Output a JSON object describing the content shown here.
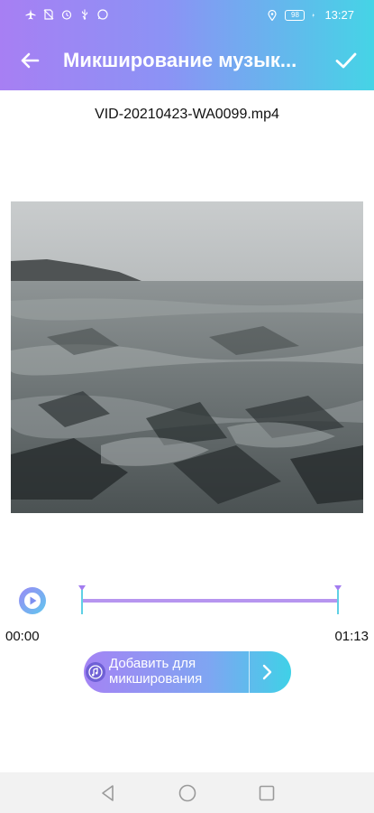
{
  "statusbar": {
    "icons_left": [
      "airplane-icon",
      "no-sim-icon",
      "alarm-icon",
      "usb-icon",
      "whatsapp-icon"
    ],
    "icons_right": [
      "location-icon",
      "battery-icon",
      "charging-icon"
    ],
    "battery": "98",
    "time": "13:27"
  },
  "header": {
    "title": "Микширование музык...",
    "back_icon": "arrow-left-icon",
    "done_icon": "checkmark-icon",
    "gradient": [
      "#a77ff3",
      "#45d4e6"
    ]
  },
  "video": {
    "filename": "VID-20210423-WA0099.mp4"
  },
  "player": {
    "play_icon": "play-icon",
    "start_time": "00:00",
    "end_time": "01:13",
    "track_color": "#b695ef"
  },
  "add_music": {
    "label": "Добавить для микширования",
    "icon": "music-add-icon",
    "arrow_icon": "chevron-right-icon"
  },
  "navbar": {
    "icons": [
      "nav-back-icon",
      "nav-home-icon",
      "nav-recent-icon"
    ]
  }
}
